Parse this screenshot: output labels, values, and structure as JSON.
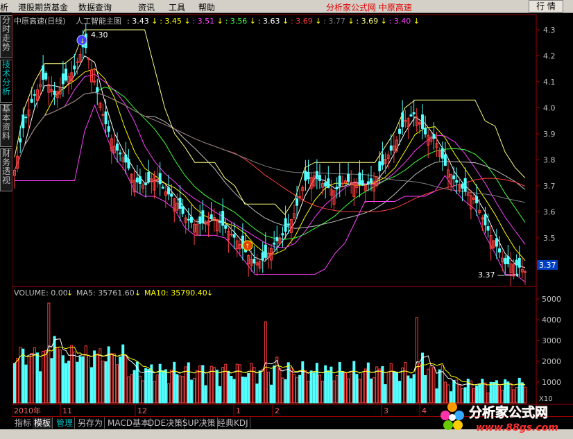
{
  "menu": {
    "items": [
      "析",
      "港股期货基金",
      "数据查询",
      "资讯",
      "工具",
      "帮助"
    ],
    "title": "分析家公式网  中原高速",
    "quote_button": "行 情"
  },
  "left_tabs": [
    "分时走势",
    "技术分析",
    "基本资料",
    "财务透视"
  ],
  "price_chart": {
    "title": "中原高速(日线)",
    "indicator": "人工智能主图",
    "legend_values": [
      {
        "value": ": 3.43",
        "color": "#ffffff"
      },
      {
        "value": ": 3.45",
        "color": "#ffff00"
      },
      {
        "value": ": 3.51",
        "color": "#ff40ff"
      },
      {
        "value": ": 3.56",
        "color": "#40ff40"
      },
      {
        "value": ": 3.63",
        "color": "#ffffff"
      },
      {
        "value": ": 3.69",
        "color": "#ff4040"
      },
      {
        "value": ": 3.77",
        "color": "#808080"
      },
      {
        "value": ": 3.69",
        "color": "#ffff80"
      },
      {
        "value": ": 3.40",
        "color": "#ff40ff"
      }
    ],
    "y_ticks": [
      "4.3",
      "4.2",
      "4.1",
      "4.0",
      "3.9",
      "3.8",
      "3.7",
      "3.6",
      "3.5",
      "3.4"
    ],
    "current_price": "3.37",
    "high_label": "4.30",
    "low_label": "3.37"
  },
  "volume_chart": {
    "label": "VOLUME: 0.00",
    "ma5": "MA5: 35761.60",
    "ma10": "MA10: 35790.40",
    "y_ticks": [
      "5000",
      "4000",
      "3000",
      "2000",
      "1000"
    ],
    "unit": "X10"
  },
  "x_axis": {
    "labels": [
      "2010年",
      "11",
      "12",
      "1",
      "2",
      "3",
      "4"
    ]
  },
  "bottom_tabs": [
    "指标",
    "模板",
    "管理",
    "另存为",
    "MACD基本",
    "DDE决策",
    "SUP决策",
    "经典KDJ"
  ],
  "watermark": {
    "text": "分析家公式网",
    "url": "www.88gs.com"
  },
  "chart_data": {
    "type": "line",
    "series": [
      {
        "values": [
          3.76,
          3.95,
          4.05,
          4.12,
          4.05,
          4.1,
          4.15,
          4.25,
          4.1,
          3.95,
          3.85,
          3.8,
          3.72,
          3.7,
          3.74,
          3.68,
          3.65,
          3.58,
          3.55,
          3.56,
          3.58,
          3.54,
          3.5,
          3.45,
          3.4,
          3.42,
          3.48,
          3.52,
          3.6,
          3.72,
          3.74,
          3.7,
          3.68,
          3.72,
          3.71,
          3.7,
          3.72,
          3.8,
          3.86,
          3.95,
          3.98,
          3.9,
          3.88,
          3.78,
          3.72,
          3.68,
          3.65,
          3.55,
          3.48,
          3.4,
          3.4,
          3.37
        ]
      }
    ]
  }
}
